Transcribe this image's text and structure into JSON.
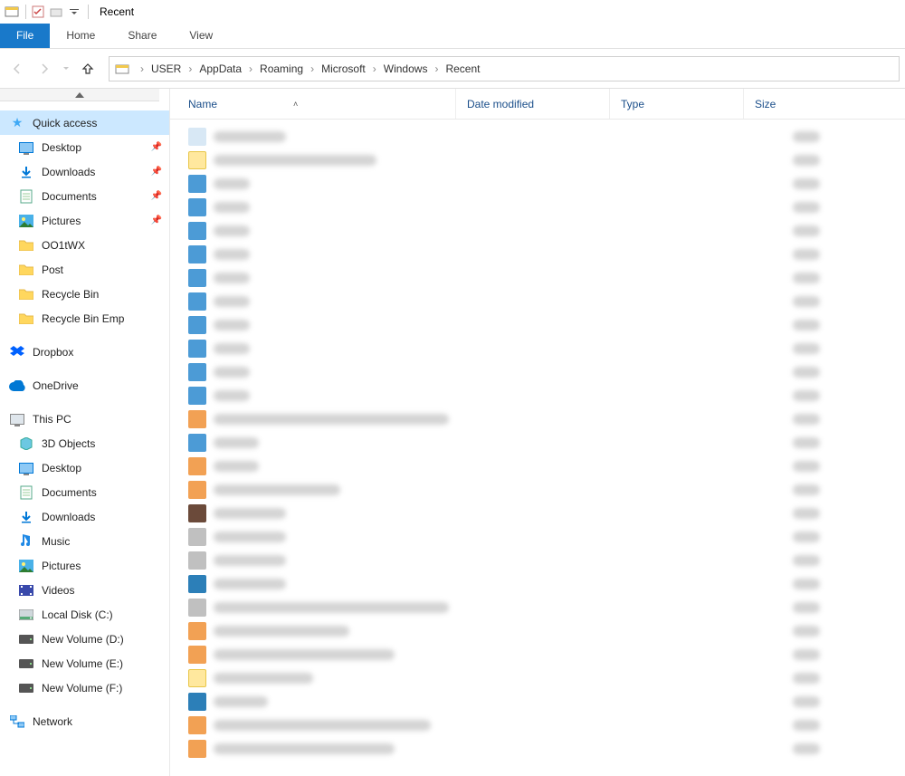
{
  "window": {
    "title": "Recent"
  },
  "ribbon": {
    "file": "File",
    "tabs": [
      "Home",
      "Share",
      "View"
    ]
  },
  "breadcrumb": [
    "USER",
    "AppData",
    "Roaming",
    "Microsoft",
    "Windows",
    "Recent"
  ],
  "sidebar": {
    "quick_access": {
      "label": "Quick access",
      "items": [
        {
          "label": "Desktop",
          "icon": "monitor",
          "pinned": true
        },
        {
          "label": "Downloads",
          "icon": "download",
          "pinned": true
        },
        {
          "label": "Documents",
          "icon": "document",
          "pinned": true
        },
        {
          "label": "Pictures",
          "icon": "pictures",
          "pinned": true
        },
        {
          "label": "OO1tWX",
          "icon": "folder",
          "pinned": false
        },
        {
          "label": "Post",
          "icon": "folder",
          "pinned": false
        },
        {
          "label": "Recycle Bin",
          "icon": "folder",
          "pinned": false
        },
        {
          "label": "Recycle Bin Emp",
          "icon": "folder",
          "pinned": false
        }
      ]
    },
    "dropbox": {
      "label": "Dropbox"
    },
    "onedrive": {
      "label": "OneDrive"
    },
    "this_pc": {
      "label": "This PC",
      "items": [
        {
          "label": "3D Objects",
          "icon": "cube"
        },
        {
          "label": "Desktop",
          "icon": "monitor"
        },
        {
          "label": "Documents",
          "icon": "document"
        },
        {
          "label": "Downloads",
          "icon": "download"
        },
        {
          "label": "Music",
          "icon": "music"
        },
        {
          "label": "Pictures",
          "icon": "pictures"
        },
        {
          "label": "Videos",
          "icon": "videos"
        },
        {
          "label": "Local Disk (C:)",
          "icon": "disk"
        },
        {
          "label": "New Volume (D:)",
          "icon": "drive"
        },
        {
          "label": "New Volume (E:)",
          "icon": "drive"
        },
        {
          "label": "New Volume (F:)",
          "icon": "drive"
        }
      ]
    },
    "network": {
      "label": "Network"
    }
  },
  "columns": {
    "name": "Name",
    "date": "Date modified",
    "type": "Type",
    "size": "Size"
  },
  "file_icons": [
    "light",
    "folder",
    "blue",
    "blue",
    "blue",
    "blue",
    "blue",
    "blue",
    "blue",
    "blue",
    "blue",
    "blue",
    "orange",
    "blue",
    "orange",
    "orange",
    "dark",
    "gray",
    "gray",
    "teal",
    "gray",
    "orange",
    "orange",
    "folder",
    "teal",
    "orange",
    "orange"
  ]
}
